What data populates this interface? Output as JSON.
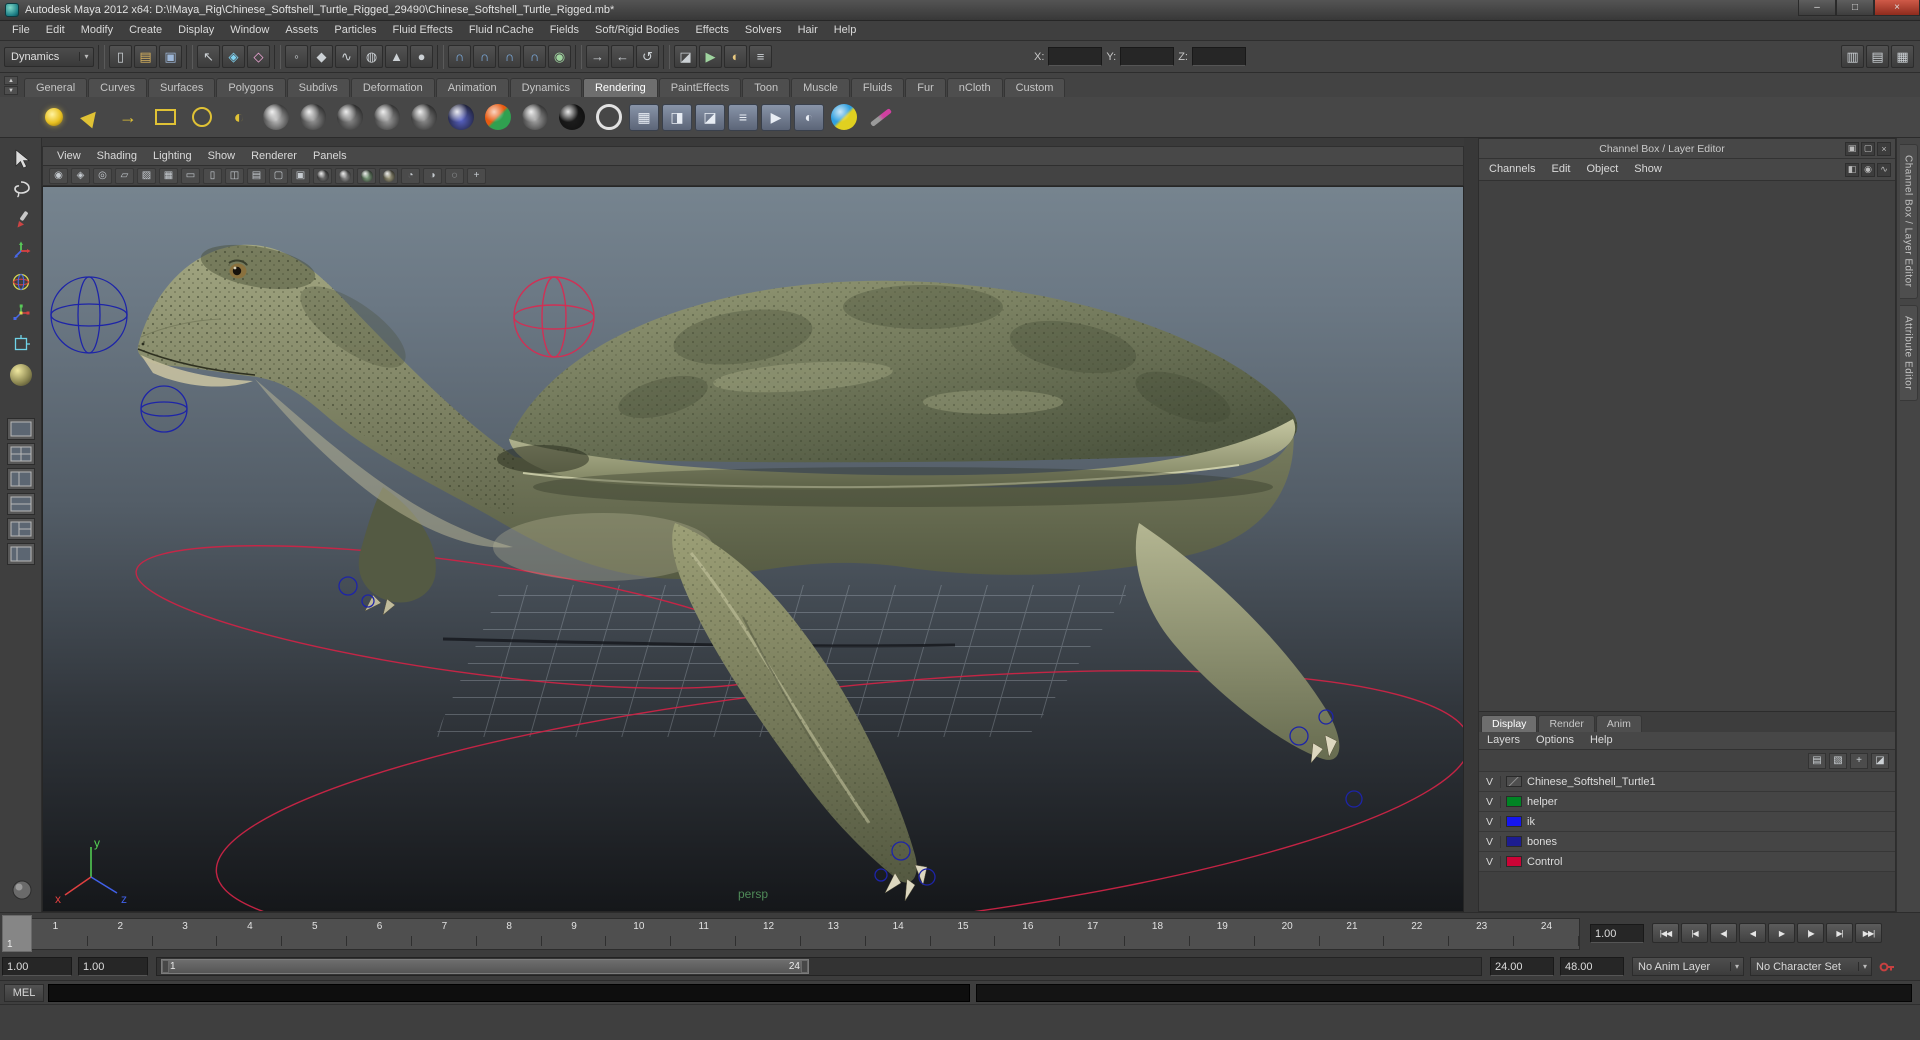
{
  "window": {
    "title": "Autodesk Maya 2012 x64: D:\\!Maya_Rig\\Chinese_Softshell_Turtle_Rigged_29490\\Chinese_Softshell_Turtle_Rigged.mb*",
    "controls": {
      "minimize": "–",
      "maximize": "□",
      "close": "×"
    }
  },
  "menubar": {
    "items": [
      "File",
      "Edit",
      "Modify",
      "Create",
      "Display",
      "Window",
      "Assets",
      "Particles",
      "Fluid Effects",
      "Fluid nCache",
      "Fields",
      "Soft/Rigid Bodies",
      "Effects",
      "Solvers",
      "Hair",
      "Help"
    ]
  },
  "status_line": {
    "menu_set": "Dynamics",
    "menu_set_arrow": "▾",
    "file_icons": [
      {
        "name": "new-scene-icon",
        "glyph": "▯"
      },
      {
        "name": "open-scene-icon",
        "glyph": "▤",
        "color": "#d8b25e"
      },
      {
        "name": "save-scene-icon",
        "glyph": "▣",
        "color": "#9db7d8"
      }
    ],
    "selection_icons": [
      {
        "name": "select-by-hierarchy-icon",
        "glyph": "↖"
      },
      {
        "name": "select-by-object-icon",
        "glyph": "◈",
        "color": "#7fd3f2"
      },
      {
        "name": "select-by-component-icon",
        "glyph": "◇",
        "color": "#f2a7d8"
      }
    ],
    "mask_icons": [
      {
        "name": "mask-handles-icon",
        "glyph": "◦"
      },
      {
        "name": "mask-joints-icon",
        "glyph": "◆"
      },
      {
        "name": "mask-curves-icon",
        "glyph": "∿"
      },
      {
        "name": "mask-surfaces-icon",
        "glyph": "◍"
      },
      {
        "name": "mask-deformers-icon",
        "glyph": "▲"
      },
      {
        "name": "mask-dynamics-icon",
        "glyph": "●"
      }
    ],
    "snap_icons": [
      {
        "name": "snap-to-grid-icon",
        "glyph": "∩",
        "color": "#7fb2e8"
      },
      {
        "name": "snap-to-curve-icon",
        "glyph": "∩",
        "color": "#7fb2e8"
      },
      {
        "name": "snap-to-point-icon",
        "glyph": "∩",
        "color": "#7fb2e8"
      },
      {
        "name": "snap-to-plane-icon",
        "glyph": "∩",
        "color": "#7fb2e8"
      },
      {
        "name": "make-live-icon",
        "glyph": "◉",
        "color": "#9fd49f"
      }
    ],
    "history_icons": [
      {
        "name": "input-connections-icon",
        "glyph": "→"
      },
      {
        "name": "output-connections-icon",
        "glyph": "←"
      },
      {
        "name": "construction-history-icon",
        "glyph": "↺"
      }
    ],
    "render_icons": [
      {
        "name": "open-render-view-icon",
        "glyph": "◪"
      },
      {
        "name": "render-current-frame-icon",
        "glyph": "▶",
        "color": "#9fd49f"
      },
      {
        "name": "ipr-render-icon",
        "glyph": "◐",
        "color": "#e8c87f"
      },
      {
        "name": "render-settings-icon",
        "glyph": "≡"
      }
    ],
    "transform": {
      "x_label": "X:",
      "y_label": "Y:",
      "z_label": "Z:",
      "x_value": "",
      "y_value": "",
      "z_value": ""
    },
    "right_icons": [
      {
        "name": "toggle-attribute-editor-icon",
        "glyph": "▥"
      },
      {
        "name": "toggle-tool-settings-icon",
        "glyph": "▤"
      },
      {
        "name": "toggle-channel-box-icon",
        "glyph": "▦"
      }
    ]
  },
  "shelf": {
    "tabs": [
      {
        "label": "General"
      },
      {
        "label": "Curves"
      },
      {
        "label": "Surfaces"
      },
      {
        "label": "Polygons"
      },
      {
        "label": "Subdivs"
      },
      {
        "label": "Deformation"
      },
      {
        "label": "Animation"
      },
      {
        "label": "Dynamics"
      },
      {
        "label": "Rendering",
        "state": "active"
      },
      {
        "label": "PaintEffects"
      },
      {
        "label": "Toon"
      },
      {
        "label": "Muscle"
      },
      {
        "label": "Fluids"
      },
      {
        "label": "Fur"
      },
      {
        "label": "nCloth"
      },
      {
        "label": "Custom"
      }
    ],
    "items": [
      {
        "name": "point-light-icon",
        "kind": "light-point",
        "glyph": ""
      },
      {
        "name": "spot-light-icon",
        "kind": "light-spot",
        "glyph": ""
      },
      {
        "name": "directional-light-icon",
        "kind": "light-directional",
        "glyph": "→"
      },
      {
        "name": "area-light-icon",
        "kind": "light-area",
        "glyph": ""
      },
      {
        "name": "volume-light-icon",
        "kind": "light-volume",
        "glyph": ""
      },
      {
        "name": "ambient-light-icon",
        "kind": "light-ambient",
        "glyph": "◐"
      },
      {
        "name": "shaded-sphere-icon",
        "kind": "kind-sphere",
        "color": "#c0c0c0",
        "glyph": ""
      },
      {
        "name": "blinn-material-icon",
        "kind": "kind-sphere",
        "color": "#9a9a9a",
        "glyph": ""
      },
      {
        "name": "lambert-material-icon",
        "kind": "kind-sphere",
        "color": "#8c8c8c",
        "glyph": ""
      },
      {
        "name": "phong-material-icon",
        "kind": "kind-sphere",
        "color": "#a4a4a4",
        "glyph": ""
      },
      {
        "name": "phong-e-material-icon",
        "kind": "kind-sphere",
        "color": "#909090",
        "glyph": ""
      },
      {
        "name": "anisotropic-material-icon",
        "kind": "kind-sphere",
        "color": "#5a64c8",
        "glyph": ""
      },
      {
        "name": "ramp-shader-icon",
        "kind": "kind-sphere-duo",
        "color": "#e85a10",
        "color2": "#30a050",
        "glyph": ""
      },
      {
        "name": "layered-shader-icon",
        "kind": "kind-sphere",
        "color": "#a8a8a8",
        "glyph": ""
      },
      {
        "name": "surface-shader-icon",
        "kind": "kind-sphere",
        "color": "#1e1e1e",
        "glyph": ""
      },
      {
        "name": "shading-map-icon",
        "kind": "kind-ring",
        "glyph": ""
      },
      {
        "name": "uv-texture-editor-icon",
        "kind": "kind-panel",
        "glyph": "▦"
      },
      {
        "name": "hypershade-icon",
        "kind": "kind-panel",
        "glyph": "◨"
      },
      {
        "name": "render-view-icon",
        "kind": "kind-panel",
        "glyph": "◪"
      },
      {
        "name": "render-settings-icon",
        "kind": "kind-panel",
        "glyph": "≡"
      },
      {
        "name": "render-current-frame-icon",
        "kind": "kind-panel",
        "glyph": "▶"
      },
      {
        "name": "ipr-render-icon",
        "kind": "kind-panel",
        "glyph": "◐"
      },
      {
        "name": "toon-shader-icon",
        "kind": "kind-sphere-duo",
        "color": "#30a0e0",
        "color2": "#e0d020",
        "glyph": ""
      },
      {
        "name": "paint-effects-brush-icon",
        "kind": "kind-brush",
        "glyph": ""
      }
    ]
  },
  "viewport": {
    "menus": [
      "View",
      "Shading",
      "Lighting",
      "Show",
      "Renderer",
      "Panels"
    ],
    "toolbar_icons": [
      {
        "name": "select-camera-icon",
        "glyph": "◉"
      },
      {
        "name": "lock-camera-icon",
        "glyph": "◈"
      },
      {
        "name": "camera-attributes-icon",
        "glyph": "◎"
      },
      {
        "name": "bookmark-icon",
        "glyph": "▱"
      },
      {
        "name": "image-plane-icon",
        "glyph": "▨"
      },
      {
        "name": "grid-toggle-icon",
        "glyph": "▦"
      },
      {
        "name": "film-gate-icon",
        "glyph": "▭"
      },
      {
        "name": "resolution-gate-icon",
        "glyph": "▯"
      },
      {
        "name": "gate-mask-icon",
        "glyph": "◫"
      },
      {
        "name": "field-chart-icon",
        "glyph": "▤"
      },
      {
        "name": "safe-action-icon",
        "glyph": "▢"
      },
      {
        "name": "safe-title-icon",
        "glyph": "▣"
      },
      {
        "name": "wireframe-mode-icon",
        "kind": "kind-sphere",
        "color": "#777777",
        "glyph": ""
      },
      {
        "name": "smooth-shade-mode-icon",
        "kind": "kind-sphere",
        "color": "#9a9a9a",
        "glyph": ""
      },
      {
        "name": "textured-mode-icon",
        "kind": "kind-sphere",
        "color": "#88aa88",
        "glyph": ""
      },
      {
        "name": "use-all-lights-icon",
        "kind": "kind-sphere",
        "color": "#aaa688",
        "glyph": ""
      },
      {
        "name": "xray-icon",
        "glyph": "◔"
      },
      {
        "name": "exposure-icon",
        "glyph": "◑"
      },
      {
        "name": "isolate-select-icon",
        "glyph": "◌"
      },
      {
        "name": "plugin-display-icon",
        "glyph": "+"
      }
    ],
    "camera_label": "persp",
    "axis": {
      "x": "x",
      "y": "y",
      "z": "z"
    }
  },
  "channel_box": {
    "title": "Channel Box / Layer Editor",
    "header_icons": [
      {
        "name": "dock-panel-icon",
        "glyph": "▣"
      },
      {
        "name": "float-panel-icon",
        "glyph": "▢"
      },
      {
        "name": "close-panel-icon",
        "glyph": "×"
      }
    ],
    "menus": [
      "Channels",
      "Edit",
      "Object",
      "Show"
    ],
    "menu_icons": [
      {
        "name": "show-manipulators-icon",
        "glyph": "◧"
      },
      {
        "name": "speed-ramp-icon",
        "glyph": "◉"
      },
      {
        "name": "hypergraph-connection-icon",
        "glyph": "∿"
      }
    ],
    "layer_editor": {
      "tabs": [
        {
          "label": "Display",
          "state": "active"
        },
        {
          "label": "Render"
        },
        {
          "label": "Anim"
        }
      ],
      "menus": [
        "Layers",
        "Options",
        "Help"
      ],
      "icons": [
        {
          "name": "layer-list-icon",
          "glyph": "▤"
        },
        {
          "name": "sort-layers-icon",
          "glyph": "▧"
        },
        {
          "name": "new-empty-layer-icon",
          "glyph": "+"
        },
        {
          "name": "new-layer-from-selected-icon",
          "glyph": "◪"
        }
      ],
      "layers": [
        {
          "visible": "V",
          "name": "Chinese_Softshell_Turtle1",
          "swatch_class": "swatch-none",
          "color": ""
        },
        {
          "visible": "V",
          "name": "helper",
          "swatch_class": "",
          "color": "#008424"
        },
        {
          "visible": "V",
          "name": "ik",
          "swatch_class": "",
          "color": "#1616ee"
        },
        {
          "visible": "V",
          "name": "bones",
          "swatch_class": "",
          "color": "#1d1d90"
        },
        {
          "visible": "V",
          "name": "Control",
          "swatch_class": "",
          "color": "#cc0436"
        }
      ]
    }
  },
  "side_tabs": [
    {
      "label": "Channel Box / Layer Editor"
    },
    {
      "label": "Attribute Editor"
    }
  ],
  "timeline": {
    "ticks": [
      "1",
      "2",
      "3",
      "4",
      "5",
      "6",
      "7",
      "8",
      "9",
      "10",
      "11",
      "12",
      "13",
      "14",
      "15",
      "16",
      "17",
      "18",
      "19",
      "20",
      "21",
      "22",
      "23",
      "24"
    ],
    "current_frame": "1",
    "speed_field": "1.00",
    "playback": [
      {
        "name": "go-to-start-button",
        "glyph": "|◀◀"
      },
      {
        "name": "step-back-frame-button",
        "glyph": "|◀"
      },
      {
        "name": "step-back-key-button",
        "glyph": "◀|"
      },
      {
        "name": "play-backwards-button",
        "glyph": "◀"
      },
      {
        "name": "play-forward-button",
        "glyph": "▶"
      },
      {
        "name": "step-forward-key-button",
        "glyph": "|▶"
      },
      {
        "name": "step-forward-frame-button",
        "glyph": "▶|"
      },
      {
        "name": "go-to-end-button",
        "glyph": "▶▶|"
      }
    ]
  },
  "range_slider": {
    "anim_start": "1.00",
    "range_start": "1.00",
    "inner_start": "1",
    "inner_end": "24",
    "range_end": "24.00",
    "anim_end": "48.00",
    "anim_layer": "No Anim Layer",
    "character_set": "No Character Set",
    "dropdown_arrow": "▾"
  },
  "command_line": {
    "label": "MEL",
    "input_value": "",
    "result_value": ""
  }
}
